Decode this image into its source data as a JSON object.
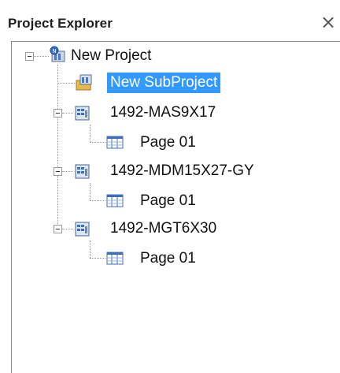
{
  "panel": {
    "title": "Project Explorer",
    "close_glyph": "×"
  },
  "tree": {
    "root": {
      "label": "New Project",
      "icon": "project-icon",
      "expanded": true
    },
    "items": [
      {
        "label": "New SubProject",
        "icon": "subproject-icon",
        "selected": true
      },
      {
        "label": "1492-MAS9X17",
        "icon": "device-icon",
        "expanded": true,
        "children": [
          {
            "label": "Page 01",
            "icon": "page-icon"
          }
        ]
      },
      {
        "label": "1492-MDM15X27-GY",
        "icon": "device-icon",
        "expanded": true,
        "children": [
          {
            "label": "Page 01",
            "icon": "page-icon"
          }
        ]
      },
      {
        "label": "1492-MGT6X30",
        "icon": "device-icon",
        "expanded": true,
        "children": [
          {
            "label": "Page 01",
            "icon": "page-icon"
          }
        ]
      }
    ]
  },
  "colors": {
    "selection": "#3399ff",
    "tree_lines": "#9a9a9a"
  }
}
